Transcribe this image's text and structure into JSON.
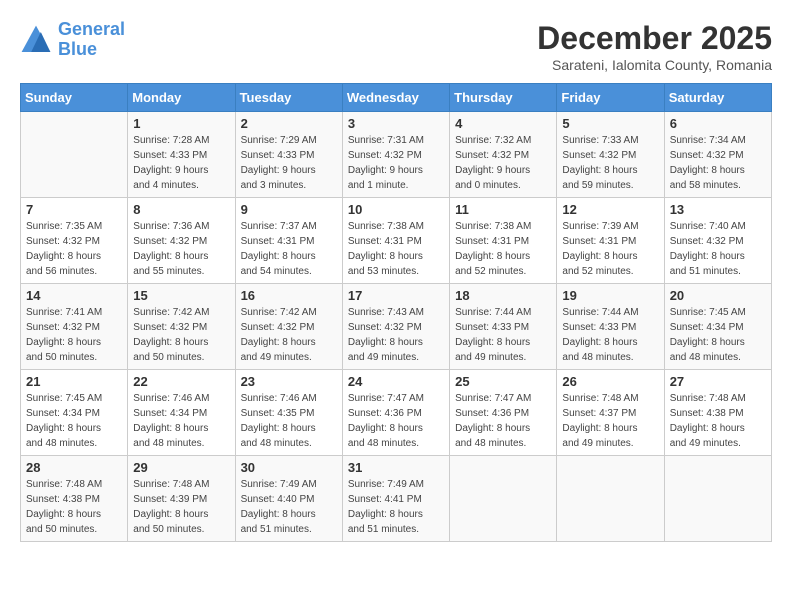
{
  "logo": {
    "line1": "General",
    "line2": "Blue"
  },
  "title": "December 2025",
  "subtitle": "Sarateni, Ialomita County, Romania",
  "days_of_week": [
    "Sunday",
    "Monday",
    "Tuesday",
    "Wednesday",
    "Thursday",
    "Friday",
    "Saturday"
  ],
  "weeks": [
    [
      {
        "day": "",
        "info": ""
      },
      {
        "day": "1",
        "info": "Sunrise: 7:28 AM\nSunset: 4:33 PM\nDaylight: 9 hours\nand 4 minutes."
      },
      {
        "day": "2",
        "info": "Sunrise: 7:29 AM\nSunset: 4:33 PM\nDaylight: 9 hours\nand 3 minutes."
      },
      {
        "day": "3",
        "info": "Sunrise: 7:31 AM\nSunset: 4:32 PM\nDaylight: 9 hours\nand 1 minute."
      },
      {
        "day": "4",
        "info": "Sunrise: 7:32 AM\nSunset: 4:32 PM\nDaylight: 9 hours\nand 0 minutes."
      },
      {
        "day": "5",
        "info": "Sunrise: 7:33 AM\nSunset: 4:32 PM\nDaylight: 8 hours\nand 59 minutes."
      },
      {
        "day": "6",
        "info": "Sunrise: 7:34 AM\nSunset: 4:32 PM\nDaylight: 8 hours\nand 58 minutes."
      }
    ],
    [
      {
        "day": "7",
        "info": "Sunrise: 7:35 AM\nSunset: 4:32 PM\nDaylight: 8 hours\nand 56 minutes."
      },
      {
        "day": "8",
        "info": "Sunrise: 7:36 AM\nSunset: 4:32 PM\nDaylight: 8 hours\nand 55 minutes."
      },
      {
        "day": "9",
        "info": "Sunrise: 7:37 AM\nSunset: 4:31 PM\nDaylight: 8 hours\nand 54 minutes."
      },
      {
        "day": "10",
        "info": "Sunrise: 7:38 AM\nSunset: 4:31 PM\nDaylight: 8 hours\nand 53 minutes."
      },
      {
        "day": "11",
        "info": "Sunrise: 7:38 AM\nSunset: 4:31 PM\nDaylight: 8 hours\nand 52 minutes."
      },
      {
        "day": "12",
        "info": "Sunrise: 7:39 AM\nSunset: 4:31 PM\nDaylight: 8 hours\nand 52 minutes."
      },
      {
        "day": "13",
        "info": "Sunrise: 7:40 AM\nSunset: 4:32 PM\nDaylight: 8 hours\nand 51 minutes."
      }
    ],
    [
      {
        "day": "14",
        "info": "Sunrise: 7:41 AM\nSunset: 4:32 PM\nDaylight: 8 hours\nand 50 minutes."
      },
      {
        "day": "15",
        "info": "Sunrise: 7:42 AM\nSunset: 4:32 PM\nDaylight: 8 hours\nand 50 minutes."
      },
      {
        "day": "16",
        "info": "Sunrise: 7:42 AM\nSunset: 4:32 PM\nDaylight: 8 hours\nand 49 minutes."
      },
      {
        "day": "17",
        "info": "Sunrise: 7:43 AM\nSunset: 4:32 PM\nDaylight: 8 hours\nand 49 minutes."
      },
      {
        "day": "18",
        "info": "Sunrise: 7:44 AM\nSunset: 4:33 PM\nDaylight: 8 hours\nand 49 minutes."
      },
      {
        "day": "19",
        "info": "Sunrise: 7:44 AM\nSunset: 4:33 PM\nDaylight: 8 hours\nand 48 minutes."
      },
      {
        "day": "20",
        "info": "Sunrise: 7:45 AM\nSunset: 4:34 PM\nDaylight: 8 hours\nand 48 minutes."
      }
    ],
    [
      {
        "day": "21",
        "info": "Sunrise: 7:45 AM\nSunset: 4:34 PM\nDaylight: 8 hours\nand 48 minutes."
      },
      {
        "day": "22",
        "info": "Sunrise: 7:46 AM\nSunset: 4:34 PM\nDaylight: 8 hours\nand 48 minutes."
      },
      {
        "day": "23",
        "info": "Sunrise: 7:46 AM\nSunset: 4:35 PM\nDaylight: 8 hours\nand 48 minutes."
      },
      {
        "day": "24",
        "info": "Sunrise: 7:47 AM\nSunset: 4:36 PM\nDaylight: 8 hours\nand 48 minutes."
      },
      {
        "day": "25",
        "info": "Sunrise: 7:47 AM\nSunset: 4:36 PM\nDaylight: 8 hours\nand 48 minutes."
      },
      {
        "day": "26",
        "info": "Sunrise: 7:48 AM\nSunset: 4:37 PM\nDaylight: 8 hours\nand 49 minutes."
      },
      {
        "day": "27",
        "info": "Sunrise: 7:48 AM\nSunset: 4:38 PM\nDaylight: 8 hours\nand 49 minutes."
      }
    ],
    [
      {
        "day": "28",
        "info": "Sunrise: 7:48 AM\nSunset: 4:38 PM\nDaylight: 8 hours\nand 50 minutes."
      },
      {
        "day": "29",
        "info": "Sunrise: 7:48 AM\nSunset: 4:39 PM\nDaylight: 8 hours\nand 50 minutes."
      },
      {
        "day": "30",
        "info": "Sunrise: 7:49 AM\nSunset: 4:40 PM\nDaylight: 8 hours\nand 51 minutes."
      },
      {
        "day": "31",
        "info": "Sunrise: 7:49 AM\nSunset: 4:41 PM\nDaylight: 8 hours\nand 51 minutes."
      },
      {
        "day": "",
        "info": ""
      },
      {
        "day": "",
        "info": ""
      },
      {
        "day": "",
        "info": ""
      }
    ]
  ]
}
